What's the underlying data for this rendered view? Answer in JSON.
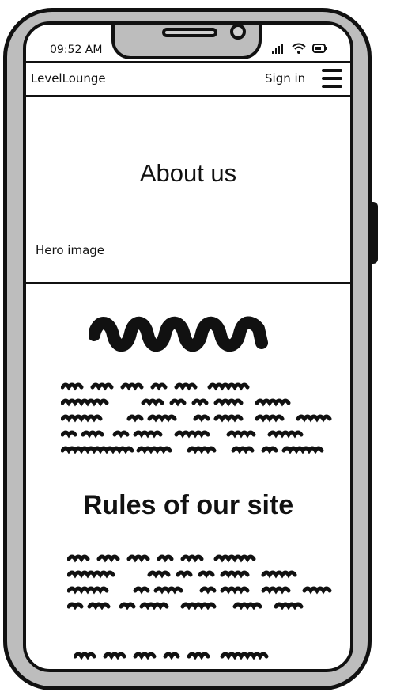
{
  "status_bar": {
    "time": "09:52 AM",
    "icons": [
      "signal-icon",
      "wifi-icon",
      "battery-icon"
    ]
  },
  "navbar": {
    "brand": "LevelLounge",
    "sign_in": "Sign in",
    "menu_icon": "hamburger-menu-icon"
  },
  "hero": {
    "title": "About us",
    "label": "Hero image"
  },
  "rules": {
    "title": "Rules of our site"
  }
}
